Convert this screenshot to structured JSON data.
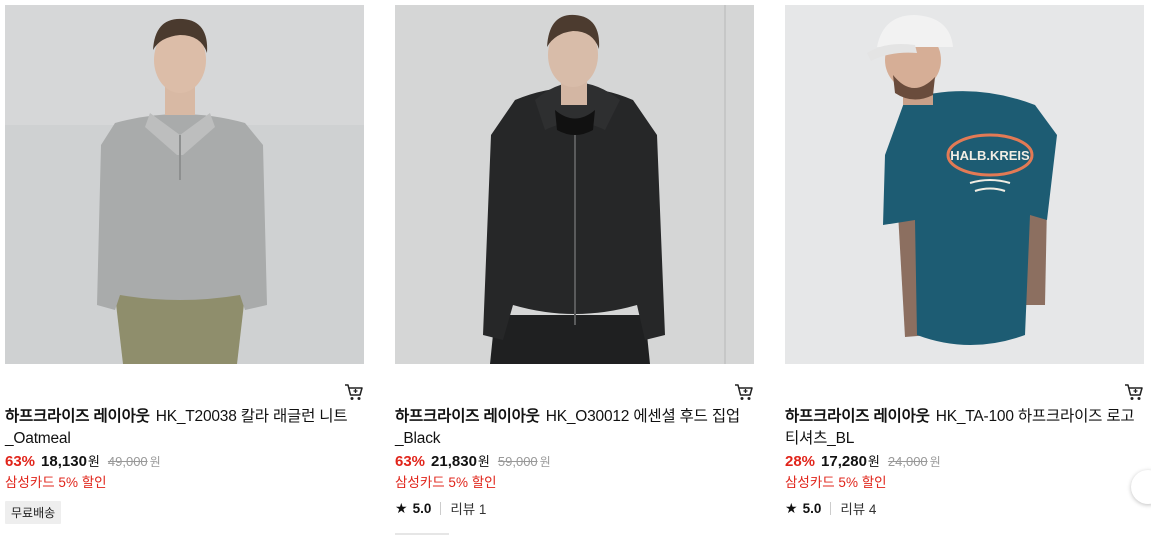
{
  "products": [
    {
      "brand": "하프크라이즈 레이아웃",
      "name": "HK_T20038 칼라 래글런 니트_Oatmeal",
      "discount": "63%",
      "price": "18,130",
      "currency": "원",
      "original_price": "49,000",
      "card_promo": "삼성카드 5% 할인",
      "badge": "무료배송"
    },
    {
      "brand": "하프크라이즈 레이아웃",
      "name": "HK_O30012 에센셜 후드 집업_Black",
      "discount": "63%",
      "price": "21,830",
      "currency": "원",
      "original_price": "59,000",
      "card_promo": "삼성카드 5% 할인",
      "rating": "5.0",
      "review_label": "리뷰 1"
    },
    {
      "brand": "하프크라이즈 레이아웃",
      "name": "HK_TA-100 하프크라이즈 로고 티셔츠_BL",
      "discount": "28%",
      "price": "17,280",
      "currency": "원",
      "original_price": "24,000",
      "card_promo": "삼성카드 5% 할인",
      "rating": "5.0",
      "review_label": "리뷰 4",
      "print_text": "HALB.KREIS"
    }
  ],
  "icons": {
    "cart": "shopping-cart-icon",
    "star": "star-icon"
  },
  "colors": {
    "discount": "#e1251b",
    "promo": "#e1251b",
    "badge_bg": "#eeeeee",
    "teal_shirt": "#1d5c73"
  }
}
